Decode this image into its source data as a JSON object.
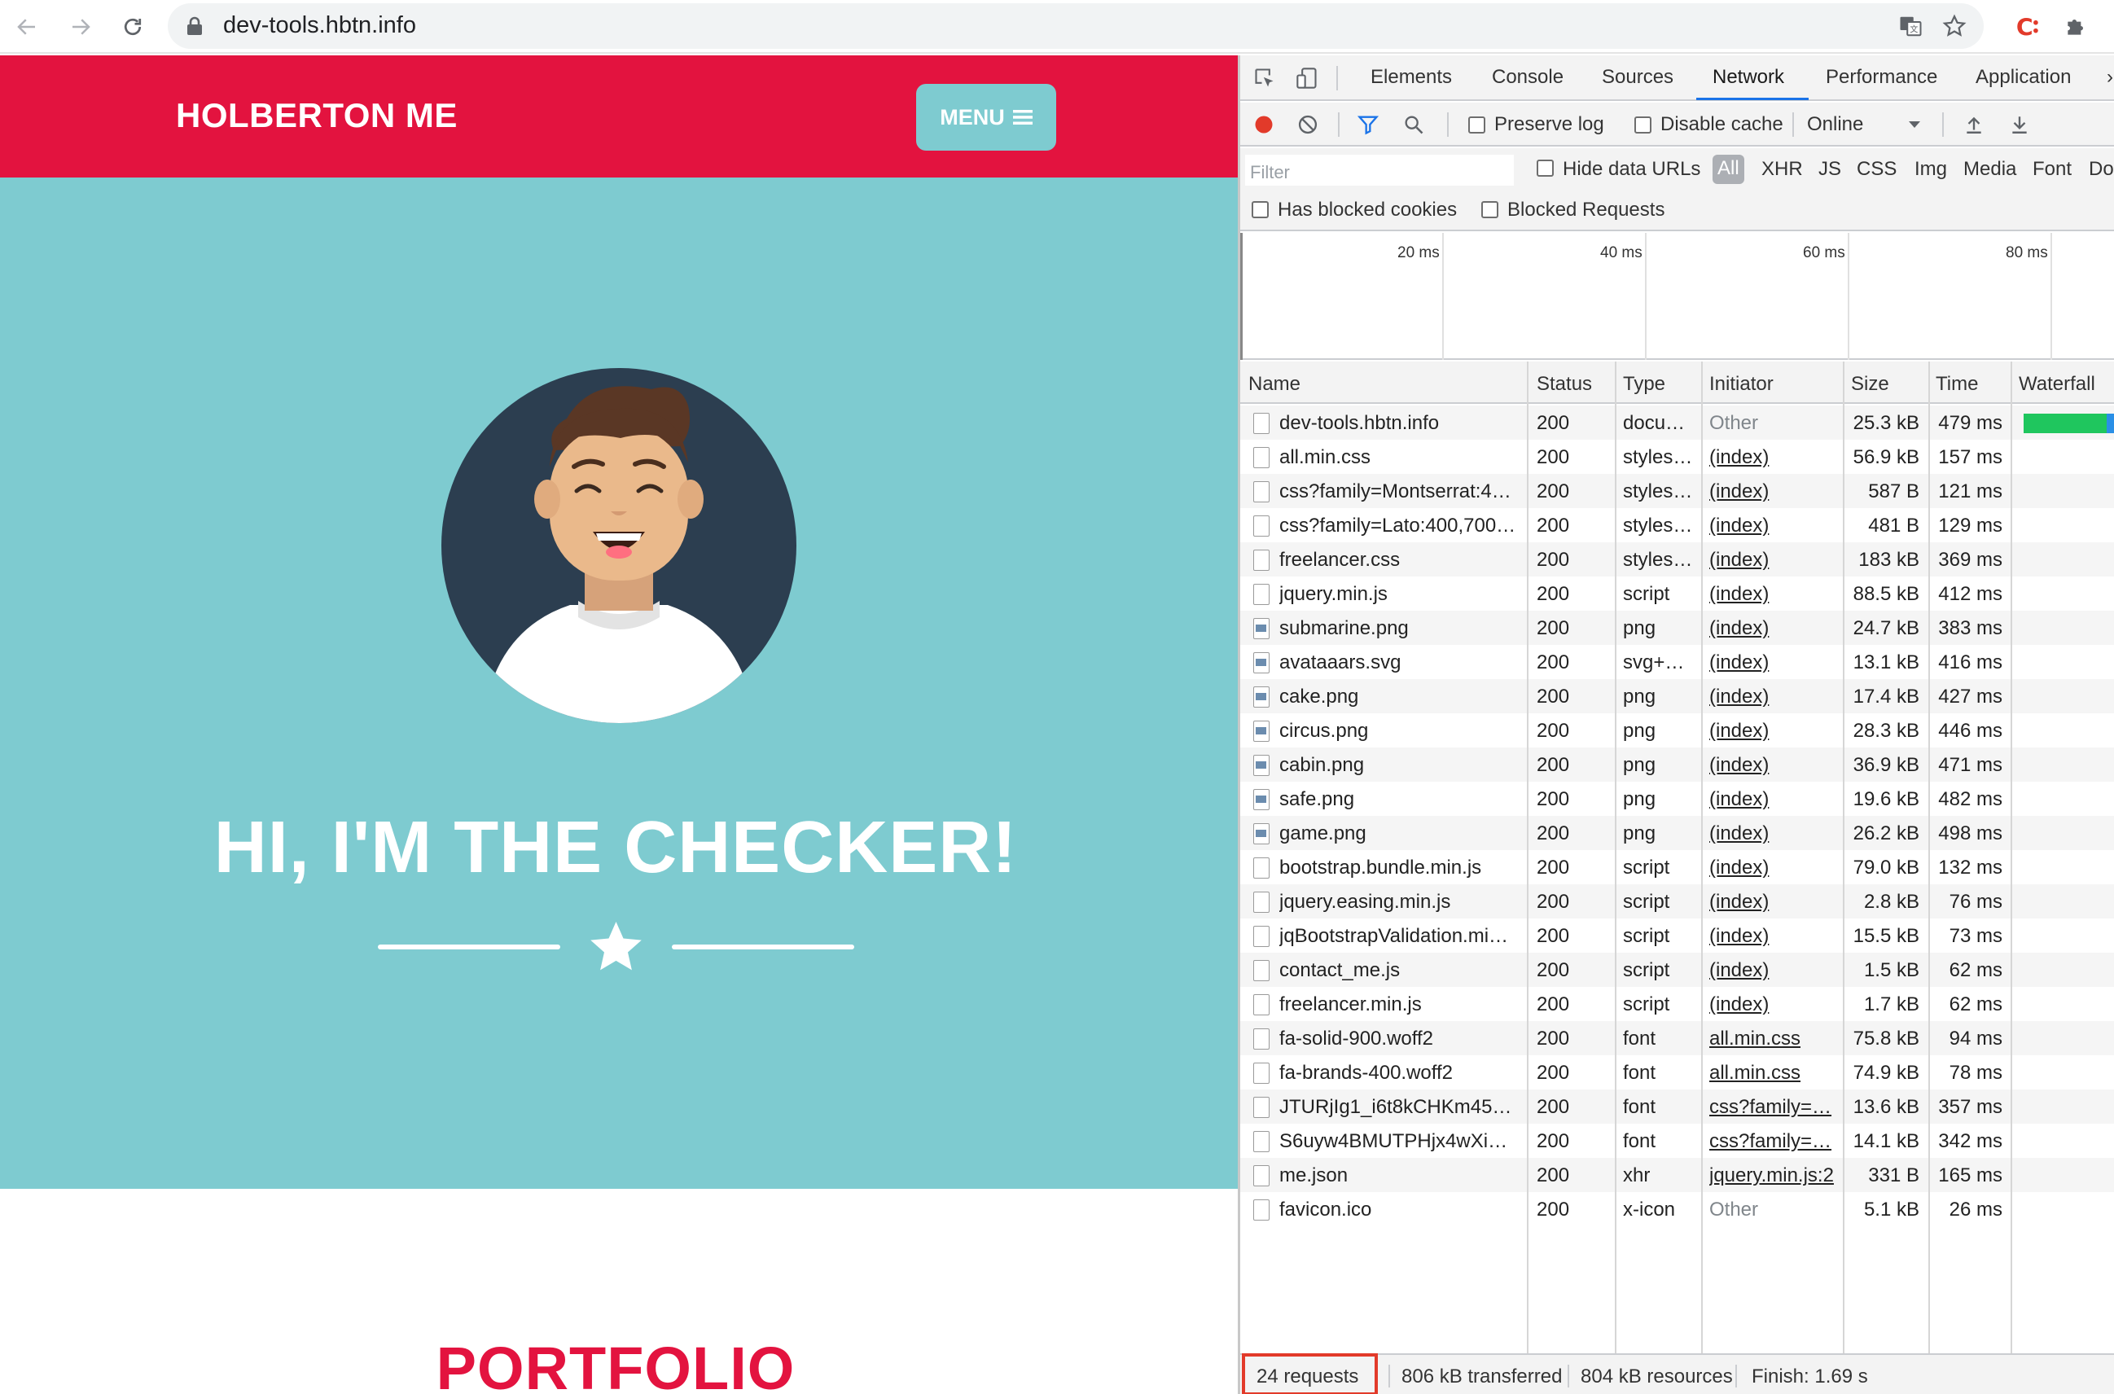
{
  "browser": {
    "url": "dev-tools.hbtn.info"
  },
  "site": {
    "brand": "HOLBERTON ME",
    "menu_label": "MENU",
    "hero_title": "HI, I'M THE CHECKER!",
    "section_title": "PORTFOLIO",
    "colors": {
      "primary": "#e3133f",
      "teal": "#7ecbd0"
    }
  },
  "devtools": {
    "tabs": [
      "Elements",
      "Console",
      "Sources",
      "Network",
      "Performance",
      "Application"
    ],
    "active_tab": "Network",
    "toolbar": {
      "preserve_log": "Preserve log",
      "disable_cache": "Disable cache",
      "throttle": "Online"
    },
    "filter": {
      "placeholder": "Filter",
      "hide_data_urls": "Hide data URLs",
      "types": [
        "All",
        "XHR",
        "JS",
        "CSS",
        "Img",
        "Media",
        "Font",
        "Doc"
      ],
      "has_blocked_cookies": "Has blocked cookies",
      "blocked_requests": "Blocked Requests"
    },
    "overview_ticks": [
      "20 ms",
      "40 ms",
      "60 ms",
      "80 ms"
    ],
    "columns": [
      "Name",
      "Status",
      "Type",
      "Initiator",
      "Size",
      "Time",
      "Waterfall"
    ],
    "requests": [
      {
        "name": "dev-tools.hbtn.info",
        "status": "200",
        "type": "docu…",
        "initiator": "Other",
        "size": "25.3 kB",
        "time": "479 ms",
        "icon": "doc"
      },
      {
        "name": "all.min.css",
        "status": "200",
        "type": "styles…",
        "initiator": "(index)",
        "size": "56.9 kB",
        "time": "157 ms",
        "icon": "doc"
      },
      {
        "name": "css?family=Montserrat:4…",
        "status": "200",
        "type": "styles…",
        "initiator": "(index)",
        "size": "587 B",
        "time": "121 ms",
        "icon": "doc"
      },
      {
        "name": "css?family=Lato:400,700…",
        "status": "200",
        "type": "styles…",
        "initiator": "(index)",
        "size": "481 B",
        "time": "129 ms",
        "icon": "doc"
      },
      {
        "name": "freelancer.css",
        "status": "200",
        "type": "styles…",
        "initiator": "(index)",
        "size": "183 kB",
        "time": "369 ms",
        "icon": "doc"
      },
      {
        "name": "jquery.min.js",
        "status": "200",
        "type": "script",
        "initiator": "(index)",
        "size": "88.5 kB",
        "time": "412 ms",
        "icon": "doc"
      },
      {
        "name": "submarine.png",
        "status": "200",
        "type": "png",
        "initiator": "(index)",
        "size": "24.7 kB",
        "time": "383 ms",
        "icon": "img"
      },
      {
        "name": "avataaars.svg",
        "status": "200",
        "type": "svg+…",
        "initiator": "(index)",
        "size": "13.1 kB",
        "time": "416 ms",
        "icon": "img"
      },
      {
        "name": "cake.png",
        "status": "200",
        "type": "png",
        "initiator": "(index)",
        "size": "17.4 kB",
        "time": "427 ms",
        "icon": "img"
      },
      {
        "name": "circus.png",
        "status": "200",
        "type": "png",
        "initiator": "(index)",
        "size": "28.3 kB",
        "time": "446 ms",
        "icon": "img"
      },
      {
        "name": "cabin.png",
        "status": "200",
        "type": "png",
        "initiator": "(index)",
        "size": "36.9 kB",
        "time": "471 ms",
        "icon": "img"
      },
      {
        "name": "safe.png",
        "status": "200",
        "type": "png",
        "initiator": "(index)",
        "size": "19.6 kB",
        "time": "482 ms",
        "icon": "img"
      },
      {
        "name": "game.png",
        "status": "200",
        "type": "png",
        "initiator": "(index)",
        "size": "26.2 kB",
        "time": "498 ms",
        "icon": "img"
      },
      {
        "name": "bootstrap.bundle.min.js",
        "status": "200",
        "type": "script",
        "initiator": "(index)",
        "size": "79.0 kB",
        "time": "132 ms",
        "icon": "doc"
      },
      {
        "name": "jquery.easing.min.js",
        "status": "200",
        "type": "script",
        "initiator": "(index)",
        "size": "2.8 kB",
        "time": "76 ms",
        "icon": "doc"
      },
      {
        "name": "jqBootstrapValidation.mi…",
        "status": "200",
        "type": "script",
        "initiator": "(index)",
        "size": "15.5 kB",
        "time": "73 ms",
        "icon": "doc"
      },
      {
        "name": "contact_me.js",
        "status": "200",
        "type": "script",
        "initiator": "(index)",
        "size": "1.5 kB",
        "time": "62 ms",
        "icon": "doc"
      },
      {
        "name": "freelancer.min.js",
        "status": "200",
        "type": "script",
        "initiator": "(index)",
        "size": "1.7 kB",
        "time": "62 ms",
        "icon": "doc"
      },
      {
        "name": "fa-solid-900.woff2",
        "status": "200",
        "type": "font",
        "initiator": "all.min.css",
        "size": "75.8 kB",
        "time": "94 ms",
        "icon": "doc"
      },
      {
        "name": "fa-brands-400.woff2",
        "status": "200",
        "type": "font",
        "initiator": "all.min.css",
        "size": "74.9 kB",
        "time": "78 ms",
        "icon": "doc"
      },
      {
        "name": "JTURjIg1_i6t8kCHKm45…",
        "status": "200",
        "type": "font",
        "initiator": "css?family=…",
        "size": "13.6 kB",
        "time": "357 ms",
        "icon": "doc"
      },
      {
        "name": "S6uyw4BMUTPHjx4wXi…",
        "status": "200",
        "type": "font",
        "initiator": "css?family=…",
        "size": "14.1 kB",
        "time": "342 ms",
        "icon": "doc"
      },
      {
        "name": "me.json",
        "status": "200",
        "type": "xhr",
        "initiator": "jquery.min.js:2",
        "size": "331 B",
        "time": "165 ms",
        "icon": "doc"
      },
      {
        "name": "favicon.ico",
        "status": "200",
        "type": "x-icon",
        "initiator": "Other",
        "size": "5.1 kB",
        "time": "26 ms",
        "icon": "doc"
      }
    ],
    "summary": {
      "requests": "24 requests",
      "transferred": "806 kB transferred",
      "resources": "804 kB resources",
      "finish": "Finish: 1.69 s"
    }
  }
}
